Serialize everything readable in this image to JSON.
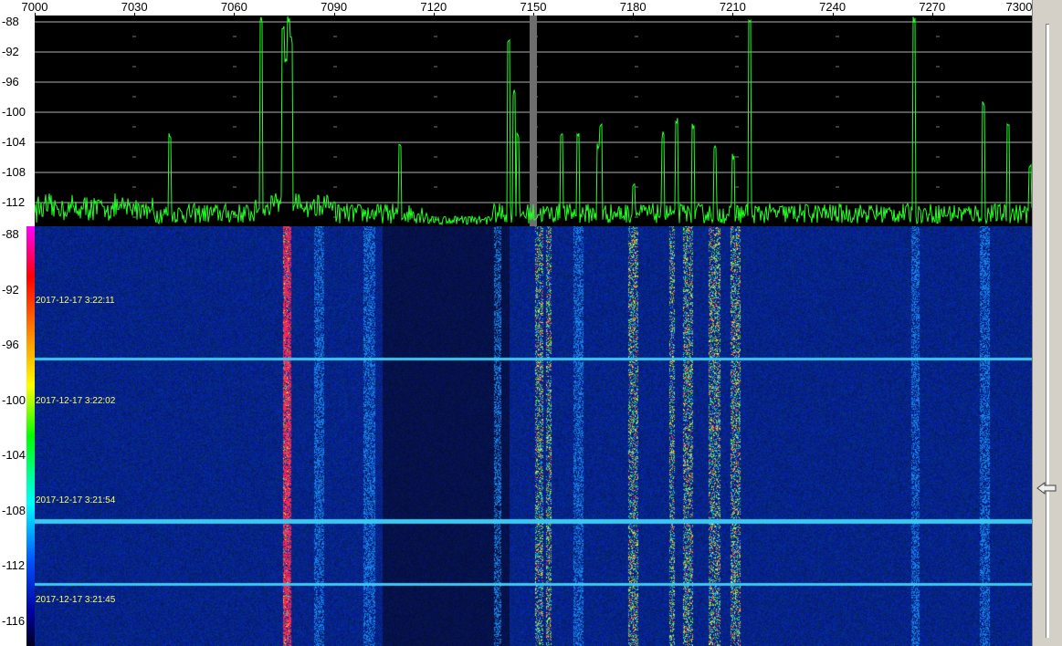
{
  "frequency_axis": {
    "labels": [
      "7000",
      "7030",
      "7060",
      "7090",
      "7120",
      "7150",
      "7180",
      "7210",
      "7240",
      "7270",
      "7300"
    ],
    "min": 7000,
    "max": 7300
  },
  "spectrum": {
    "db_labels": [
      "-88",
      "-92",
      "-96",
      "-100",
      "-104",
      "-108",
      "-112"
    ],
    "db_max": -88,
    "db_min": -116,
    "trace_color": "#22ff22",
    "grid_color": "#b0b0b0",
    "tuned_frequency": 7150
  },
  "waterfall": {
    "db_labels": [
      "-88",
      "-92",
      "-96",
      "-100",
      "-104",
      "-108",
      "-112",
      "-116"
    ],
    "timestamps": [
      "2017-12-17 3:22:11",
      "2017-12-17 3:22:02",
      "2017-12-17 3:21:54",
      "2017-12-17 3:21:45"
    ],
    "background_color": "#0a1a6e"
  },
  "icons": {
    "slider_thumb": "arrow-left-icon"
  }
}
